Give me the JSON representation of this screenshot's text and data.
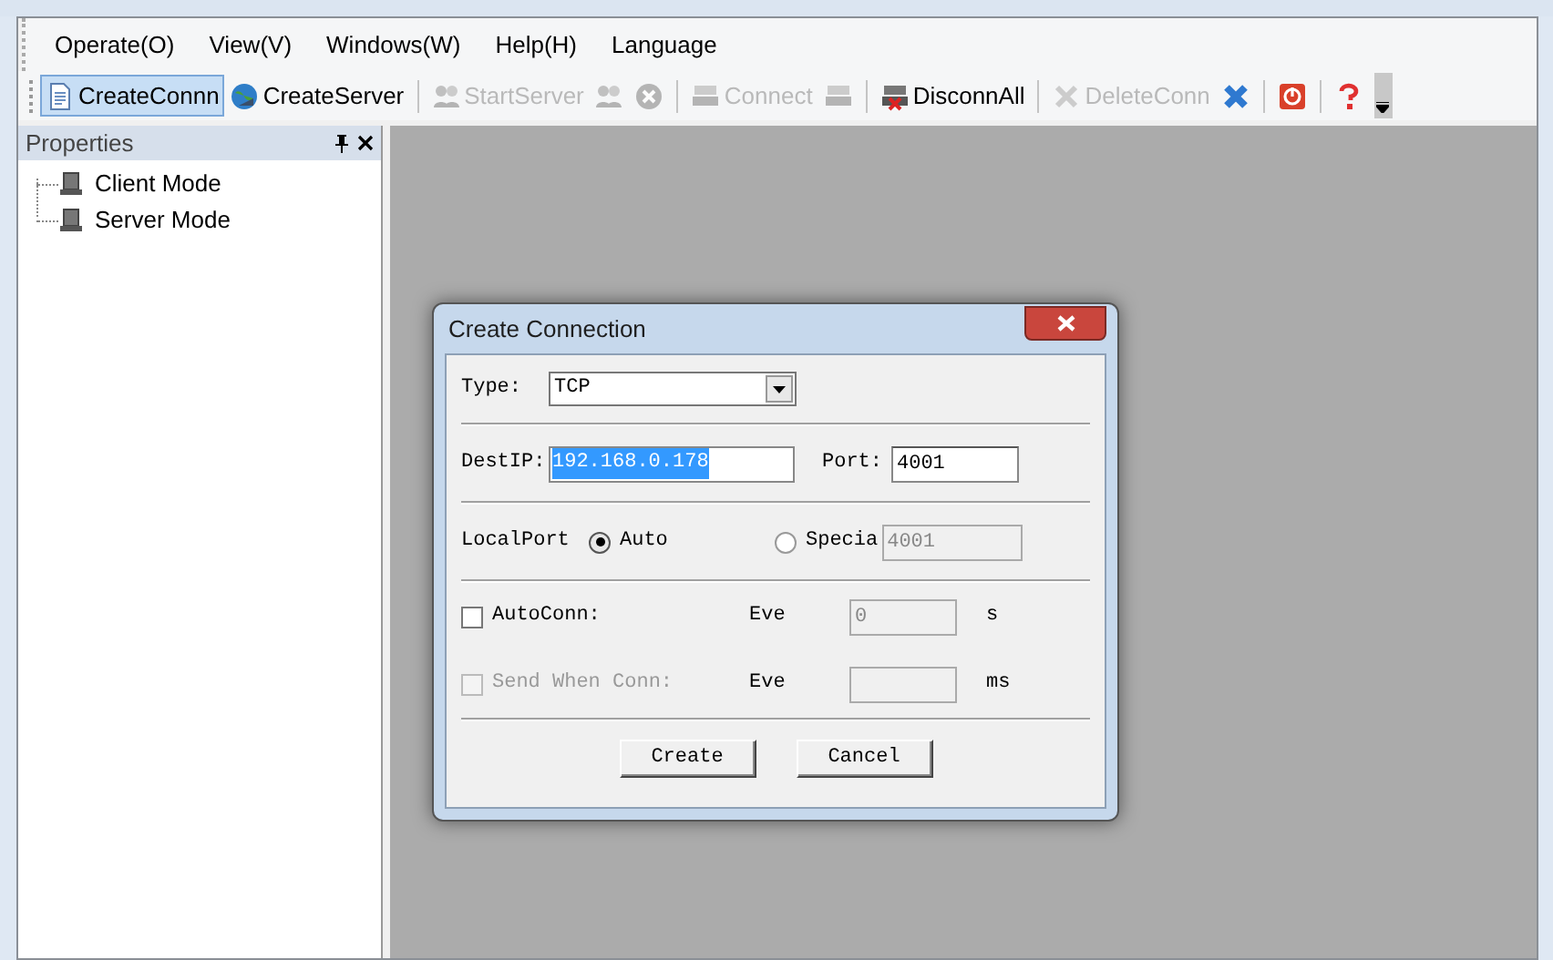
{
  "menu": [
    {
      "label": "Operate(O)"
    },
    {
      "label": "View(V)"
    },
    {
      "label": "Windows(W)"
    },
    {
      "label": "Help(H)"
    },
    {
      "label": "Language"
    }
  ],
  "toolbar": [
    {
      "kind": "button",
      "label": "CreateConnn",
      "selected": true,
      "disabled": false
    },
    {
      "kind": "button",
      "label": "CreateServer",
      "selected": false,
      "disabled": false
    },
    {
      "kind": "separator"
    },
    {
      "kind": "button",
      "label": "StartServer",
      "selected": false,
      "disabled": true
    },
    {
      "kind": "icon",
      "selected": false,
      "disabled": true
    },
    {
      "kind": "icon",
      "selected": false,
      "disabled": true
    },
    {
      "kind": "separator"
    },
    {
      "kind": "button",
      "label": "Connect",
      "selected": false,
      "disabled": true
    },
    {
      "kind": "icon",
      "selected": false,
      "disabled": true
    },
    {
      "kind": "separator"
    },
    {
      "kind": "button",
      "label": "DisconnAll",
      "selected": false,
      "disabled": false
    },
    {
      "kind": "separator"
    },
    {
      "kind": "button",
      "label": "DeleteConn",
      "selected": false,
      "disabled": true
    },
    {
      "kind": "icon",
      "selected": false,
      "disabled": false
    },
    {
      "kind": "separator"
    },
    {
      "kind": "icon",
      "selected": false,
      "disabled": false
    },
    {
      "kind": "separator"
    },
    {
      "kind": "icon",
      "selected": false,
      "disabled": false
    }
  ],
  "properties": {
    "title": "Properties",
    "tree": [
      {
        "label": "Client Mode"
      },
      {
        "label": "Server Mode"
      }
    ]
  },
  "dialog": {
    "title": "Create Connection",
    "type": {
      "label": "Type:",
      "value": "TCP"
    },
    "dest_ip": {
      "label": "DestIP:",
      "value": "192.168.0.178",
      "selected": true
    },
    "port": {
      "label": "Port:",
      "value": "4001"
    },
    "local_port": {
      "label": "LocalPort",
      "options": [
        {
          "label": "Auto",
          "selected": true
        },
        {
          "label": "Specia",
          "selected": false
        }
      ],
      "value": "4001",
      "disabled": true
    },
    "auto_conn": {
      "label": "AutoConn:",
      "checked": false,
      "disabled": false,
      "every": "Eve",
      "value": "0",
      "unit": "s"
    },
    "send_when_conn": {
      "label": "Send When Conn:",
      "checked": false,
      "disabled": true,
      "every": "Eve",
      "unit": "ms"
    },
    "buttons": [
      "Create",
      "Cancel"
    ]
  }
}
